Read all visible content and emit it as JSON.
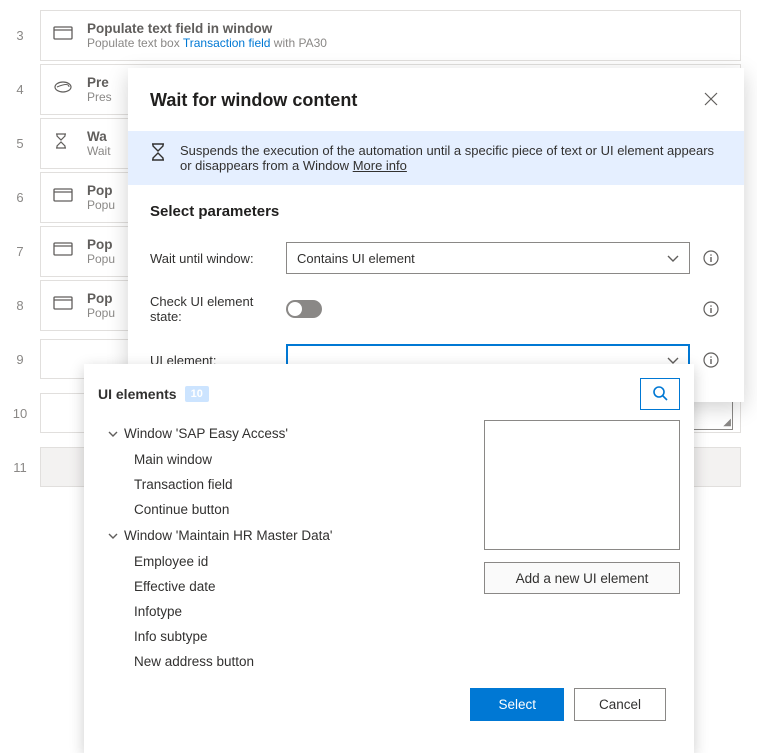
{
  "steps": [
    {
      "num": "3",
      "title": "Populate text field in window",
      "sub_a": "Populate text box ",
      "sub_link": "Transaction field",
      "sub_b": " with ",
      "sub_c": "PA30"
    },
    {
      "num": "4",
      "title": "Pre",
      "sub_a": "Pres"
    },
    {
      "num": "5",
      "title": "Wa",
      "sub_a": "Wait"
    },
    {
      "num": "6",
      "title": "Pop",
      "sub_a": "Popu"
    },
    {
      "num": "7",
      "title": "Pop",
      "sub_a": "Popu"
    },
    {
      "num": "8",
      "title": "Pop",
      "sub_a": "Popu"
    },
    {
      "num": "9"
    },
    {
      "num": "10"
    },
    {
      "num": "11"
    }
  ],
  "dialog": {
    "title": "Wait for window content",
    "banner": "Suspends the execution of the automation until a specific piece of text or UI element appears or disappears from a Window ",
    "more_info": "More info",
    "section_title": "Select parameters",
    "wait_label": "Wait until window:",
    "wait_value": "Contains UI element",
    "check_label": "Check UI element state:",
    "ui_element_label": "UI element:"
  },
  "popup": {
    "title": "UI elements",
    "count": "10",
    "tree": {
      "group1": "Window 'SAP Easy Access'",
      "g1_items": [
        "Main window",
        "Transaction field",
        "Continue button"
      ],
      "group2": "Window 'Maintain HR Master Data'",
      "g2_items": [
        "Employee id",
        "Effective date",
        "Infotype",
        "Info subtype",
        "New address button"
      ]
    },
    "add_button": "Add a new UI element",
    "select": "Select",
    "cancel": "Cancel"
  }
}
